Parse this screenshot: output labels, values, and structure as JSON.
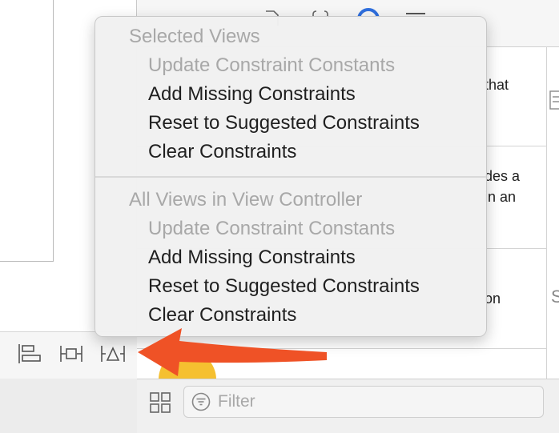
{
  "popup_menu": {
    "selected_views": {
      "header": "Selected Views",
      "items": [
        {
          "label": "Update Constraint Constants",
          "enabled": false
        },
        {
          "label": "Add Missing Constraints",
          "enabled": true
        },
        {
          "label": "Reset to Suggested Constraints",
          "enabled": true
        },
        {
          "label": "Clear Constraints",
          "enabled": true
        }
      ]
    },
    "all_views": {
      "header": "All Views in View Controller",
      "items": [
        {
          "label": "Update Constraint Constants",
          "enabled": false
        },
        {
          "label": "Add Missing Constraints",
          "enabled": true
        },
        {
          "label": "Reset to Suggested Constraints",
          "enabled": true
        },
        {
          "label": "Clear Constraints",
          "enabled": true
        }
      ]
    }
  },
  "library_fragments": [
    "that",
    "des a",
    "in an",
    "on"
  ],
  "library_partial_glyph": "S",
  "filter": {
    "placeholder": "Filter"
  },
  "colors": {
    "arrow": "#ef5226",
    "menu_bg": "#f1f1f1",
    "disabled_text": "#a8a8a8",
    "accent_blue": "#2f6fde",
    "yellow_badge": "#f5c030"
  },
  "icons": {
    "align": "align-icon",
    "pin": "pin-icon",
    "resolve": "resolve-auto-layout-issues-icon",
    "grid": "grid-view-icon",
    "filter": "filter-icon"
  }
}
